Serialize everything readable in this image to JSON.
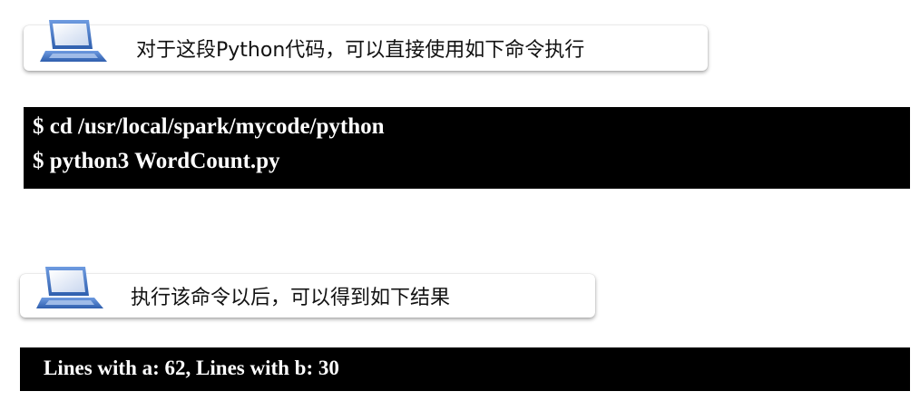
{
  "section1": {
    "text": "对于这段Python代码，可以直接使用如下命令执行",
    "icon": "laptop-icon"
  },
  "terminal1": {
    "lines": [
      "$ cd /usr/local/spark/mycode/python",
      "$ python3 WordCount.py"
    ]
  },
  "section2": {
    "text": "执行该命令以后，可以得到如下结果",
    "icon": "laptop-icon"
  },
  "terminal2": {
    "lines": [
      "Lines with a: 62, Lines with b: 30"
    ]
  },
  "colors": {
    "terminal_bg": "#000000",
    "terminal_text": "#ffffff",
    "icon_blue": "#4a7fcf"
  }
}
